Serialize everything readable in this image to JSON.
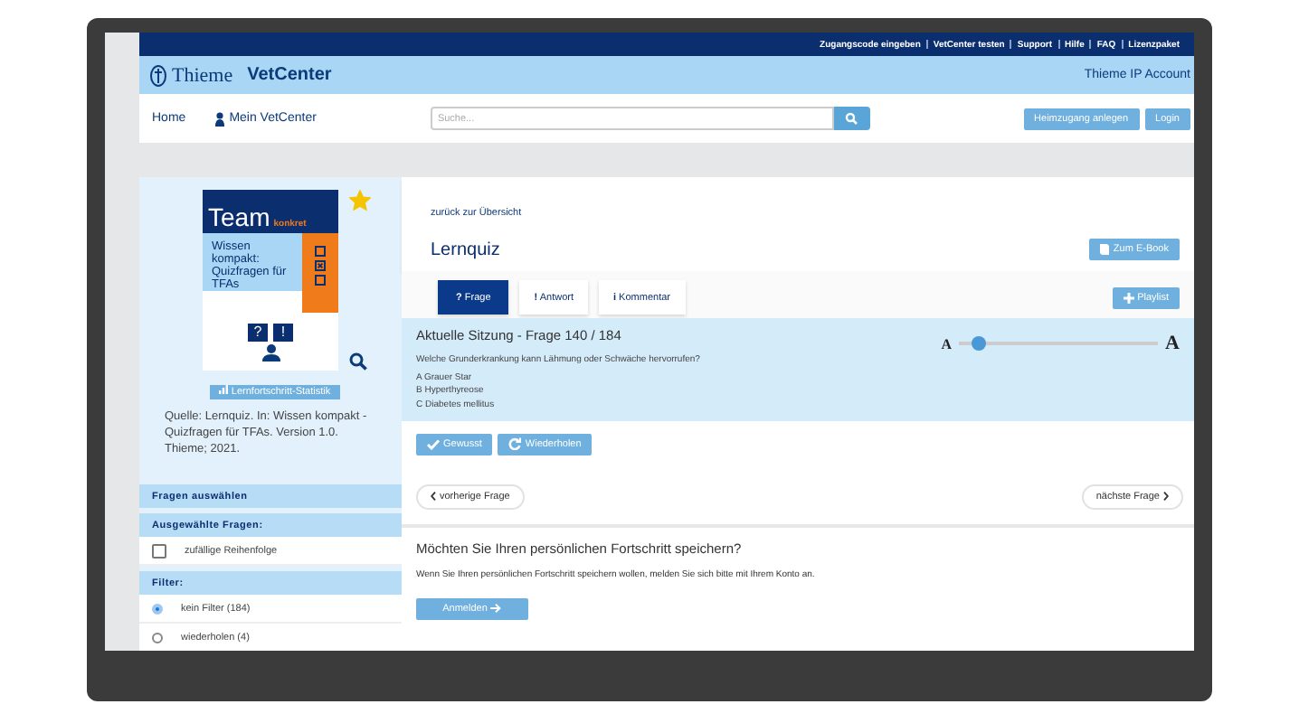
{
  "top_links": [
    "Zugangscode eingeben",
    "VetCenter testen",
    "Support",
    "Hilfe",
    "FAQ",
    "Lizenzpaket"
  ],
  "header": {
    "logo_word": "Thieme",
    "site_name": "VetCenter",
    "account": "Thieme IP Account"
  },
  "nav": {
    "home": "Home",
    "my_center": "Mein VetCenter",
    "search": {
      "placeholder": "Suche..."
    },
    "buttons": [
      "Heimzugang anlegen",
      "Login"
    ]
  },
  "sidebar": {
    "cover": {
      "title": "Team",
      "badge": "konkret",
      "subtitle": "Wissen kompakt: Quizfragen für TFAs",
      "marks": [
        "?",
        "!"
      ],
      "checkboxes": [
        {
          "checked": false
        },
        {
          "checked": true
        },
        {
          "checked": false
        }
      ]
    },
    "favorite": true,
    "stats_button": "Lernfortschritt-Statistik",
    "source": "Quelle: Lernquiz. In: Wissen kompakt - Quizfragen für TFAs. Version 1.0. Thieme; 2021.",
    "sections": [
      {
        "kind": "header",
        "label": "Fragen auswählen"
      },
      {
        "kind": "header",
        "label": "Ausgewählte Fragen:"
      },
      {
        "kind": "checkbox",
        "label": "zufällige Reihenfolge",
        "checked": false
      },
      {
        "kind": "header",
        "label": "Filter:"
      },
      {
        "kind": "radio",
        "label": "kein Filter (184)",
        "selected": true
      },
      {
        "kind": "radio",
        "label": "wiederholen (4)",
        "selected": false
      }
    ]
  },
  "main": {
    "back_link": "zurück zur Übersicht",
    "title": "Lernquiz",
    "ebook_button": "Zum E-Book",
    "tabs": [
      {
        "icon": "?",
        "label": "Frage",
        "selected": true
      },
      {
        "icon": "!",
        "label": "Antwort",
        "selected": false
      },
      {
        "icon": "i",
        "label": "Kommentar",
        "selected": false
      }
    ],
    "playlist_button": "Playlist",
    "question": {
      "heading": "Aktuelle Sitzung - Frage 140 / 184",
      "text": "Welche Grunderkrankung kann Lähmung oder Schwäche hervorrufen?",
      "options": [
        "A Grauer Star",
        "B Hyperthyreose",
        "C Diabetes mellitus"
      ]
    },
    "font_size": {
      "small": "A",
      "large": "A",
      "level": 0.1
    },
    "actions": [
      {
        "kind": "check",
        "label": "Gewusst"
      },
      {
        "kind": "redo",
        "label": "Wiederholen"
      }
    ],
    "prev": "vorherige Frage",
    "next": "nächste Frage",
    "save": {
      "heading": "Möchten Sie Ihren persönlichen Fortschritt speichern?",
      "text": "Wenn Sie Ihren persönlichen Fortschritt speichern wollen, melden Sie sich bitte mit Ihrem Konto an.",
      "button": "Anmelden"
    }
  }
}
